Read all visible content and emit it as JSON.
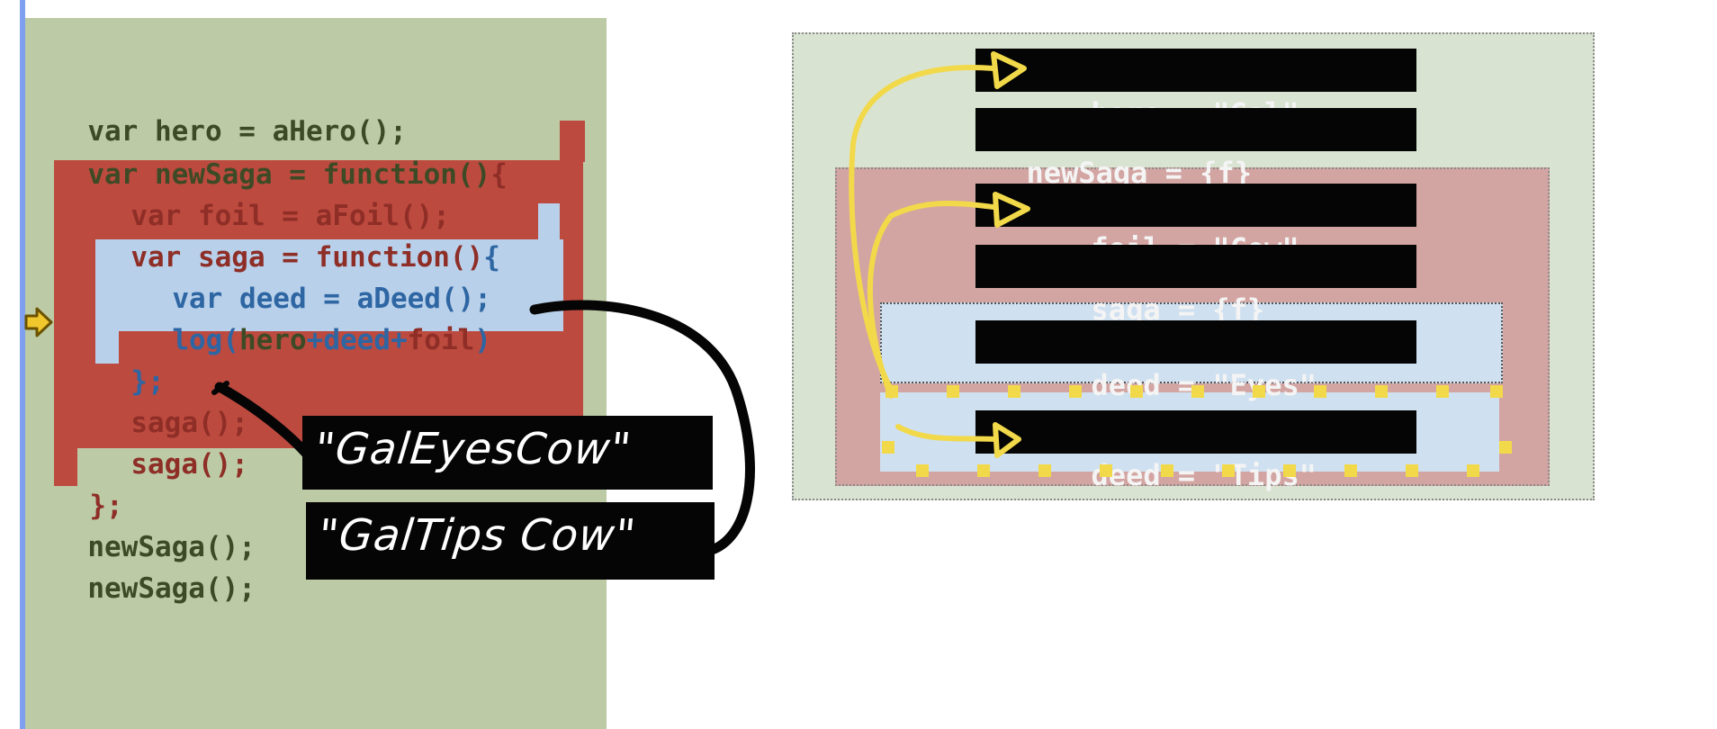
{
  "code": {
    "lines": [
      "var hero = aHero();",
      "var newSaga = function()",
      "{",
      "var foil = aFoil();",
      "var saga = function()",
      "{",
      "var deed = aDeed();",
      "log(",
      "hero",
      "+",
      "deed",
      "+",
      "foil",
      ")",
      "};",
      "saga();",
      "saga();",
      "};",
      "newSaga();",
      "newSaga();"
    ]
  },
  "outputs": [
    "\"GalEyesCow\"",
    "\"GalTips Cow\""
  ],
  "scopes": {
    "global": [
      "hero = \"Gal\"",
      "newSaga = {f}"
    ],
    "newSaga": [
      "foil = \"Cow\"",
      "saga = {f}"
    ],
    "saga_call_1": [
      "deed = \"Eyes\""
    ],
    "saga_call_2": [
      "deed = \"Tips\""
    ]
  },
  "colors": {
    "code_bg": "#bccba6",
    "scope_red": "#bd4a3f",
    "scope_blue": "#b8d0ea",
    "arrow_yellow": "#f2d94a",
    "ink": "#050505"
  },
  "icons": {
    "pointer": "current-line-arrow-icon"
  }
}
